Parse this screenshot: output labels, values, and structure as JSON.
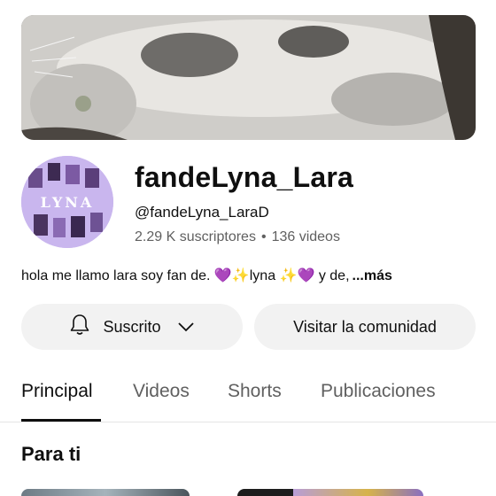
{
  "banner": {
    "image": "cat-lying-on-ground"
  },
  "avatar": {
    "image": "lyna-collage-avatar",
    "text": "LYNA",
    "bg_color": "#c9b6ee"
  },
  "channel": {
    "name": "fandeLyna_Lara",
    "handle": "@fandeLyna_LaraD",
    "subscribers": "2.29 K suscriptores",
    "separator": "•",
    "videos": "136 videos"
  },
  "description": {
    "text": "hola me llamo lara soy fan de. 💜✨lyna ✨💜 y de,",
    "more": "...más"
  },
  "buttons": {
    "subscribe_label": "Suscrito",
    "community_label": "Visitar la comunidad"
  },
  "tabs": [
    {
      "label": "Principal",
      "active": true
    },
    {
      "label": "Videos",
      "active": false
    },
    {
      "label": "Shorts",
      "active": false
    },
    {
      "label": "Publicaciones",
      "active": false
    }
  ],
  "section": {
    "title": "Para ti"
  },
  "colors": {
    "text": "#0f0f0f",
    "secondary": "#606060",
    "button_bg": "#f2f2f2"
  }
}
